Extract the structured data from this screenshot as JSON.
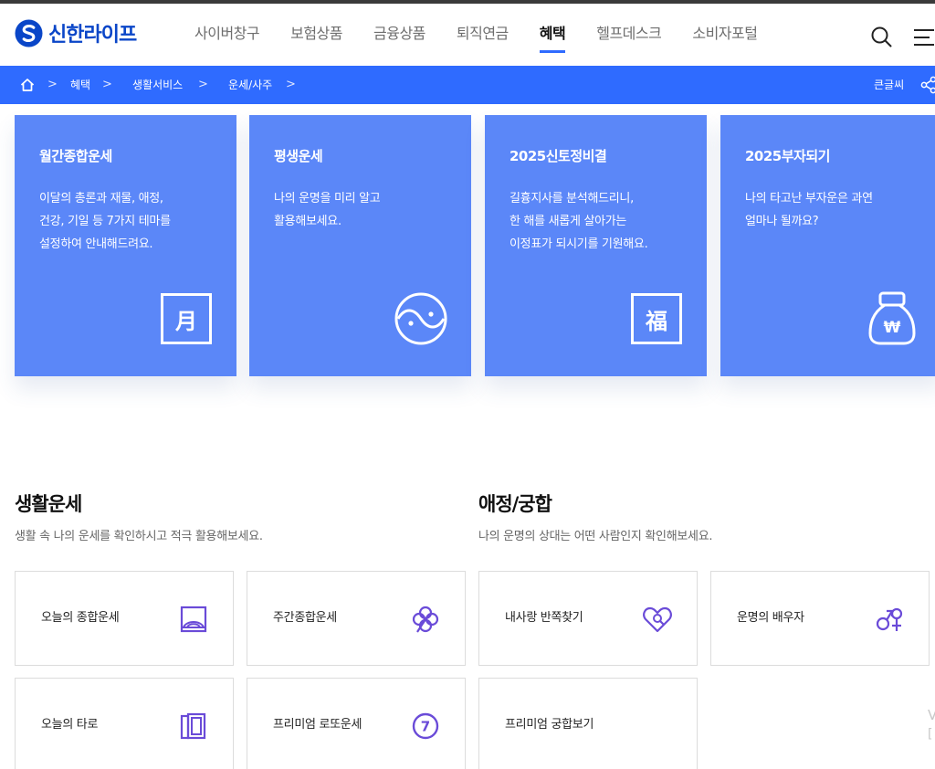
{
  "colors": {
    "brand": "#0a46c8",
    "accent": "#2f6bff",
    "card_bg": "#5b87f8",
    "icon_purple": "#6a4bd8"
  },
  "header": {
    "logo_text": "신한라이프",
    "nav": [
      "사이버창구",
      "보험상품",
      "금융상품",
      "퇴직연금",
      "혜택",
      "헬프데스크",
      "소비자포털"
    ],
    "active_nav": "혜택",
    "icons": [
      "search-icon",
      "menu-icon"
    ]
  },
  "breadcrumb": {
    "items": [
      "혜택",
      "생활서비스",
      "운세/사주"
    ],
    "big_text": "큰글씨",
    "icons": [
      "home-icon",
      "share-icon"
    ]
  },
  "cards": [
    {
      "title": "월간종합운세",
      "desc": "이달의 총론과 재물, 애정,\n건강, 기일 등 7가지 테마를\n설정하여 안내해드려요.",
      "icon": "moon-month-icon",
      "icon_char": "月"
    },
    {
      "title": "평생운세",
      "desc": "나의 운명을 미리 알고\n활용해보세요.",
      "icon": "yin-yang-icon"
    },
    {
      "title": "2025신토정비결",
      "desc": "길흉지사를 분석해드리니,\n한 해를 새롭게 살아가는\n이정표가 되시기를 기원해요.",
      "icon": "fortune-blessing-icon",
      "icon_char": "福"
    },
    {
      "title": "2025부자되기",
      "desc": "나의 타고난 부자운은 과연\n얼마나 될까요?",
      "icon": "money-bag-icon",
      "icon_char": "₩"
    }
  ],
  "sections": {
    "life": {
      "title": "생활운세",
      "subtitle": "생활 속 나의 운세를 확인하시고 적극 활용해보세요.",
      "tiles": [
        {
          "label": "오늘의 종합운세",
          "icon": "sunrise-icon"
        },
        {
          "label": "주간종합운세",
          "icon": "clover-icon"
        },
        {
          "label": "오늘의 타로",
          "icon": "tarot-cards-icon"
        },
        {
          "label": "프리미엄 로또운세",
          "icon": "lotto-ball-icon",
          "icon_char": "7"
        }
      ]
    },
    "love": {
      "title": "애정/궁합",
      "subtitle": "나의 운명의 상대는 어떤 사람인지 확인해보세요.",
      "tiles": [
        {
          "label": "내사랑 반쪽찾기",
          "icon": "heart-search-icon"
        },
        {
          "label": "운명의 배우자",
          "icon": "gender-symbols-icon"
        },
        {
          "label": "프리미엄 궁합보기",
          "icon": ""
        }
      ]
    }
  },
  "edge_text": {
    "v": "V",
    "b": "["
  }
}
